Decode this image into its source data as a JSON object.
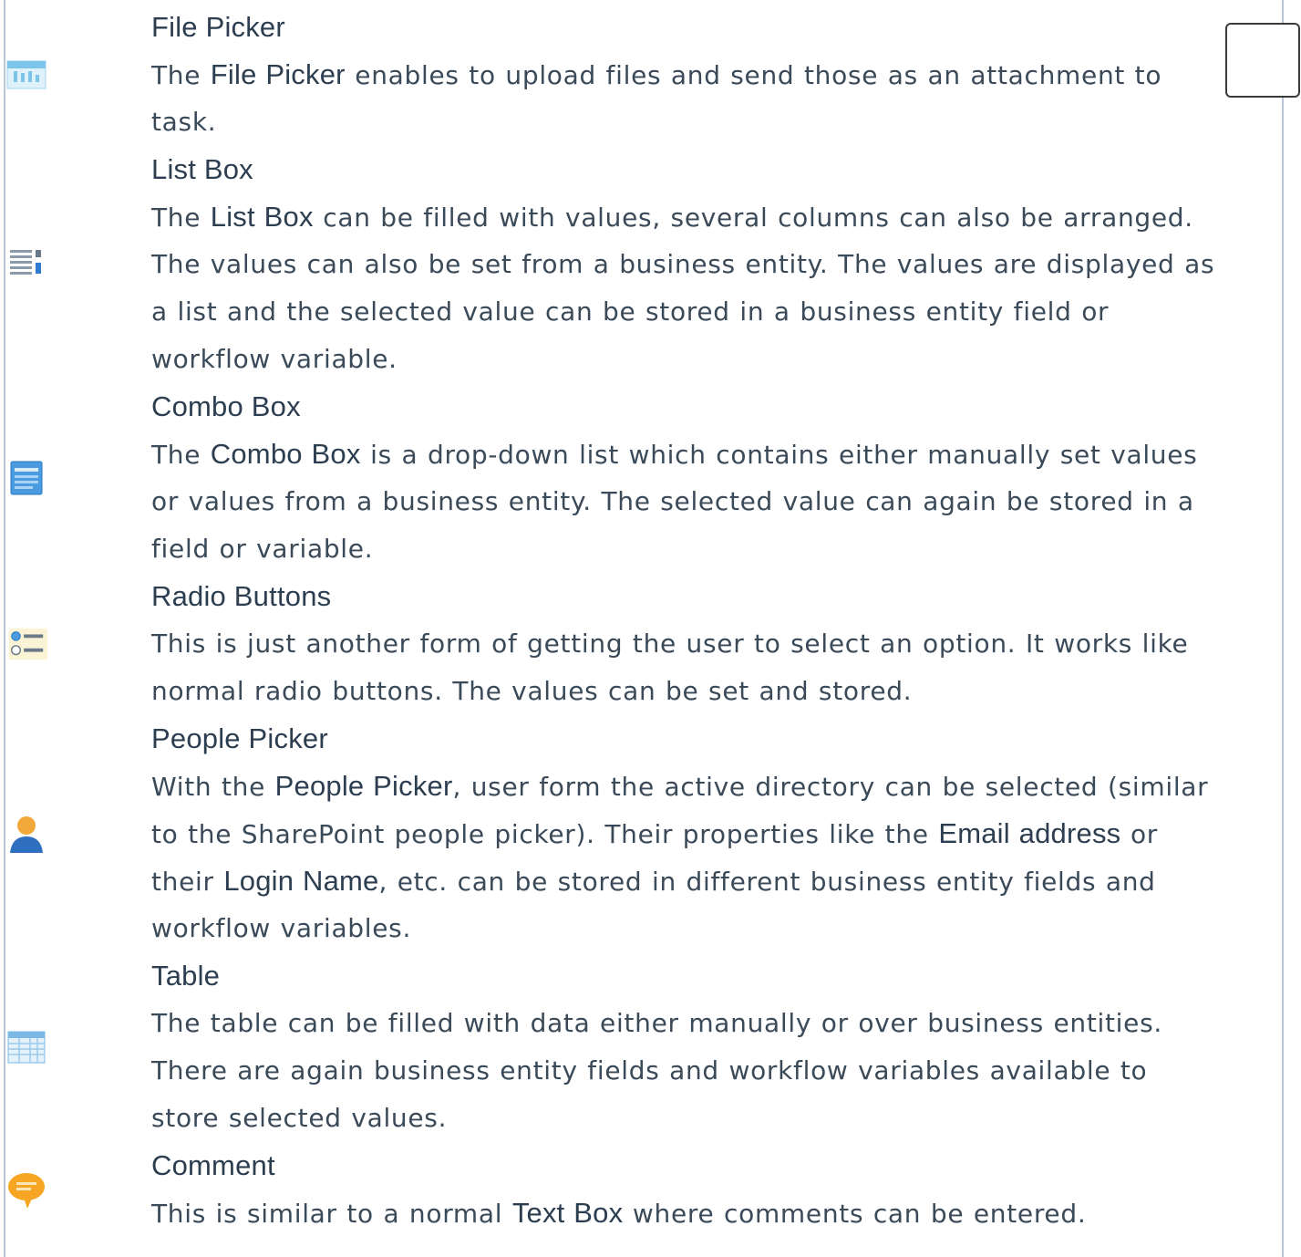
{
  "items": [
    {
      "icon": "file-picker-icon",
      "title": "File Picker",
      "lines": [
        [
          {
            "t": "The "
          },
          {
            "b": "File Picker"
          },
          {
            "t": " enables to upload files and send those as an attachment to"
          }
        ],
        [
          {
            "t": "task."
          }
        ]
      ]
    },
    {
      "icon": "list-box-icon",
      "title": "List Box",
      "lines": [
        [
          {
            "t": "The "
          },
          {
            "b": "List Box"
          },
          {
            "t": " can be filled with values, several columns can also be arranged."
          }
        ],
        [
          {
            "t": "The values can also be set from a business entity. The values are displayed as"
          }
        ],
        [
          {
            "t": "a list and the selected value can be stored in a business entity field or"
          }
        ],
        [
          {
            "t": "workflow variable."
          }
        ]
      ]
    },
    {
      "icon": "combo-box-icon",
      "title": "Combo Box",
      "lines": [
        [
          {
            "t": "The "
          },
          {
            "b": "Combo Box"
          },
          {
            "t": " is a drop-down list which contains either manually set values"
          }
        ],
        [
          {
            "t": "or values from a business entity. The selected value can again be stored in a"
          }
        ],
        [
          {
            "t": "field or variable."
          }
        ]
      ]
    },
    {
      "icon": "radio-buttons-icon",
      "title": "Radio Buttons",
      "lines": [
        [
          {
            "t": "This is just another form of getting the user to select an option. It works like"
          }
        ],
        [
          {
            "t": "normal radio buttons. The values can be set and stored."
          }
        ]
      ]
    },
    {
      "icon": "people-picker-icon",
      "title": "People Picker",
      "lines": [
        [
          {
            "t": "With the "
          },
          {
            "b": "People Picker"
          },
          {
            "t": ", user form the active directory can be selected (similar"
          }
        ],
        [
          {
            "t": "to the SharePoint people picker). Their properties like the "
          },
          {
            "b": "Email address"
          },
          {
            "t": " or"
          }
        ],
        [
          {
            "t": "their "
          },
          {
            "b": "Login Name"
          },
          {
            "t": ", etc. can be stored in different business entity fields and"
          }
        ],
        [
          {
            "t": "workflow variables."
          }
        ]
      ]
    },
    {
      "icon": "table-icon",
      "title": "Table",
      "lines": [
        [
          {
            "t": "The table can be filled with data either manually or over business entities."
          }
        ],
        [
          {
            "t": "There are again business entity fields and workflow variables available to"
          }
        ],
        [
          {
            "t": "store selected values."
          }
        ]
      ]
    },
    {
      "icon": "comment-icon",
      "title": "Comment",
      "lines": [
        [
          {
            "t": "This is similar to a normal "
          },
          {
            "b": "Text Box"
          },
          {
            "t": " where comments can be entered."
          }
        ]
      ]
    }
  ]
}
